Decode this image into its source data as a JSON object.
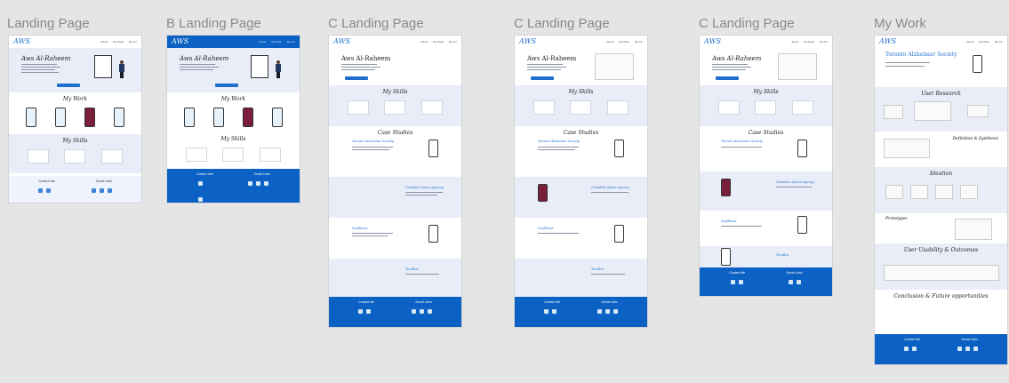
{
  "canvas": {
    "background": "#e5e5e5",
    "accent": "#0b61c4"
  },
  "frames": [
    {
      "label": "Landing Page"
    },
    {
      "label": "B Landing Page"
    },
    {
      "label": "C Landing Page"
    },
    {
      "label": "C Landing Page"
    },
    {
      "label": "C Landing Page"
    },
    {
      "label": "My Work"
    }
  ],
  "landing": {
    "logo": "AWS",
    "nav": [
      "About",
      "My Work",
      "My CV"
    ],
    "name": "Aws Al-Raheem",
    "my_work": "My Work",
    "my_skills": "My Skills",
    "contact": "Contact Info",
    "social": "Social Links"
  },
  "c_landing": {
    "name": "Aws Al-Raheem",
    "my_skills": "My Skills",
    "case_studies": "Case Studies",
    "cases": [
      "Toronto Alzheimer Society",
      "Canadian Space Agency",
      "Swifthaus",
      "TeraBox"
    ],
    "contact": "Contact Me",
    "social": "Social Links"
  },
  "mywork": {
    "title": "Toronto Alzheimer Society",
    "sections": [
      "User Research",
      "Definition & Synthesis",
      "Ideation",
      "Prototypes",
      "User Usability & Outcomes",
      "Conclusion & Future opportunities"
    ],
    "contact": "Contact Me",
    "social": "Social Links"
  }
}
